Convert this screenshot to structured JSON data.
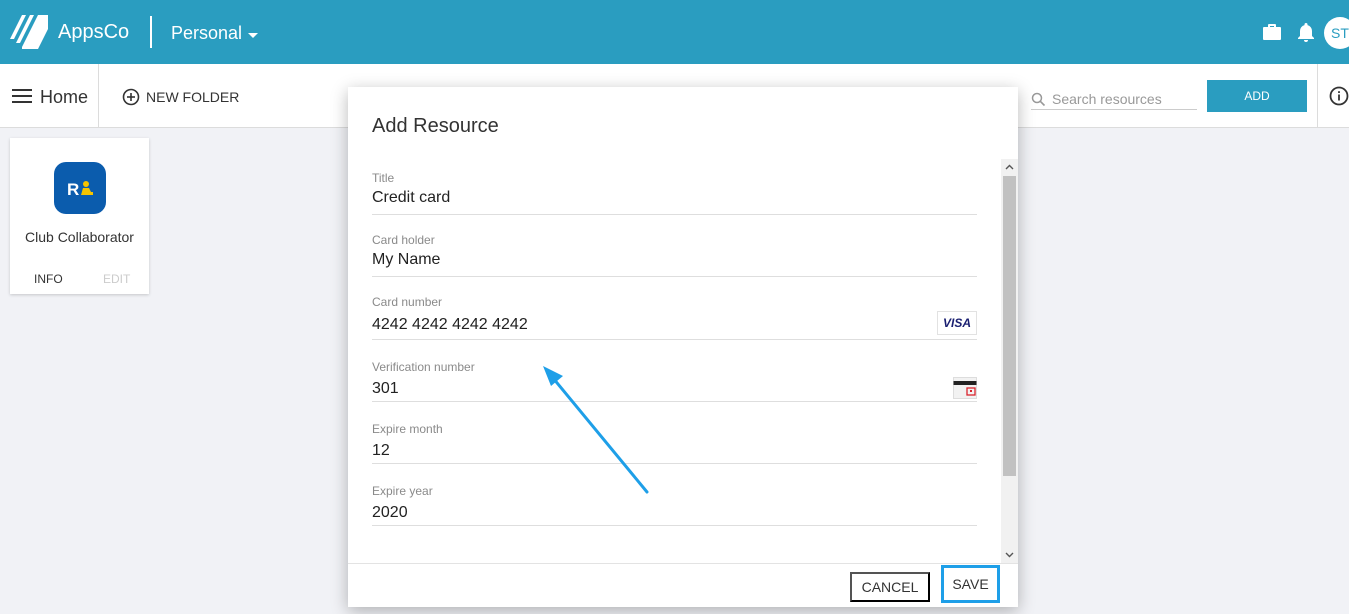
{
  "header": {
    "brand": "AppsCo",
    "account": "Personal",
    "avatar_initials": "ST"
  },
  "toolbar": {
    "home_label": "Home",
    "new_folder_label": "NEW FOLDER",
    "search_placeholder": "Search resources",
    "add_label": "ADD"
  },
  "app_card": {
    "title": "Club Collaborator",
    "info_label": "INFO",
    "edit_label": "EDIT"
  },
  "modal": {
    "title": "Add Resource",
    "fields": [
      {
        "label": "Title",
        "value": "Credit card"
      },
      {
        "label": "Card holder",
        "value": "My Name"
      },
      {
        "label": "Card number",
        "value": "4242 4242 4242 4242",
        "badge": "VISA"
      },
      {
        "label": "Verification number",
        "value": "301"
      },
      {
        "label": "Expire month",
        "value": "12"
      },
      {
        "label": "Expire year",
        "value": "2020"
      }
    ],
    "cancel_label": "CANCEL",
    "save_label": "SAVE"
  },
  "colors": {
    "brand": "#2a9dc0",
    "highlight": "#1e9fe8",
    "app_icon": "#0b5cad"
  },
  "icons": {
    "logo": "appsco-logo-icon",
    "briefcase": "briefcase-icon",
    "bell": "bell-icon",
    "menu": "menu-icon",
    "add_circle": "add-circle-icon",
    "search": "search-icon",
    "info": "info-icon",
    "card_brand": "visa-icon",
    "cvv": "cvv-card-icon"
  }
}
